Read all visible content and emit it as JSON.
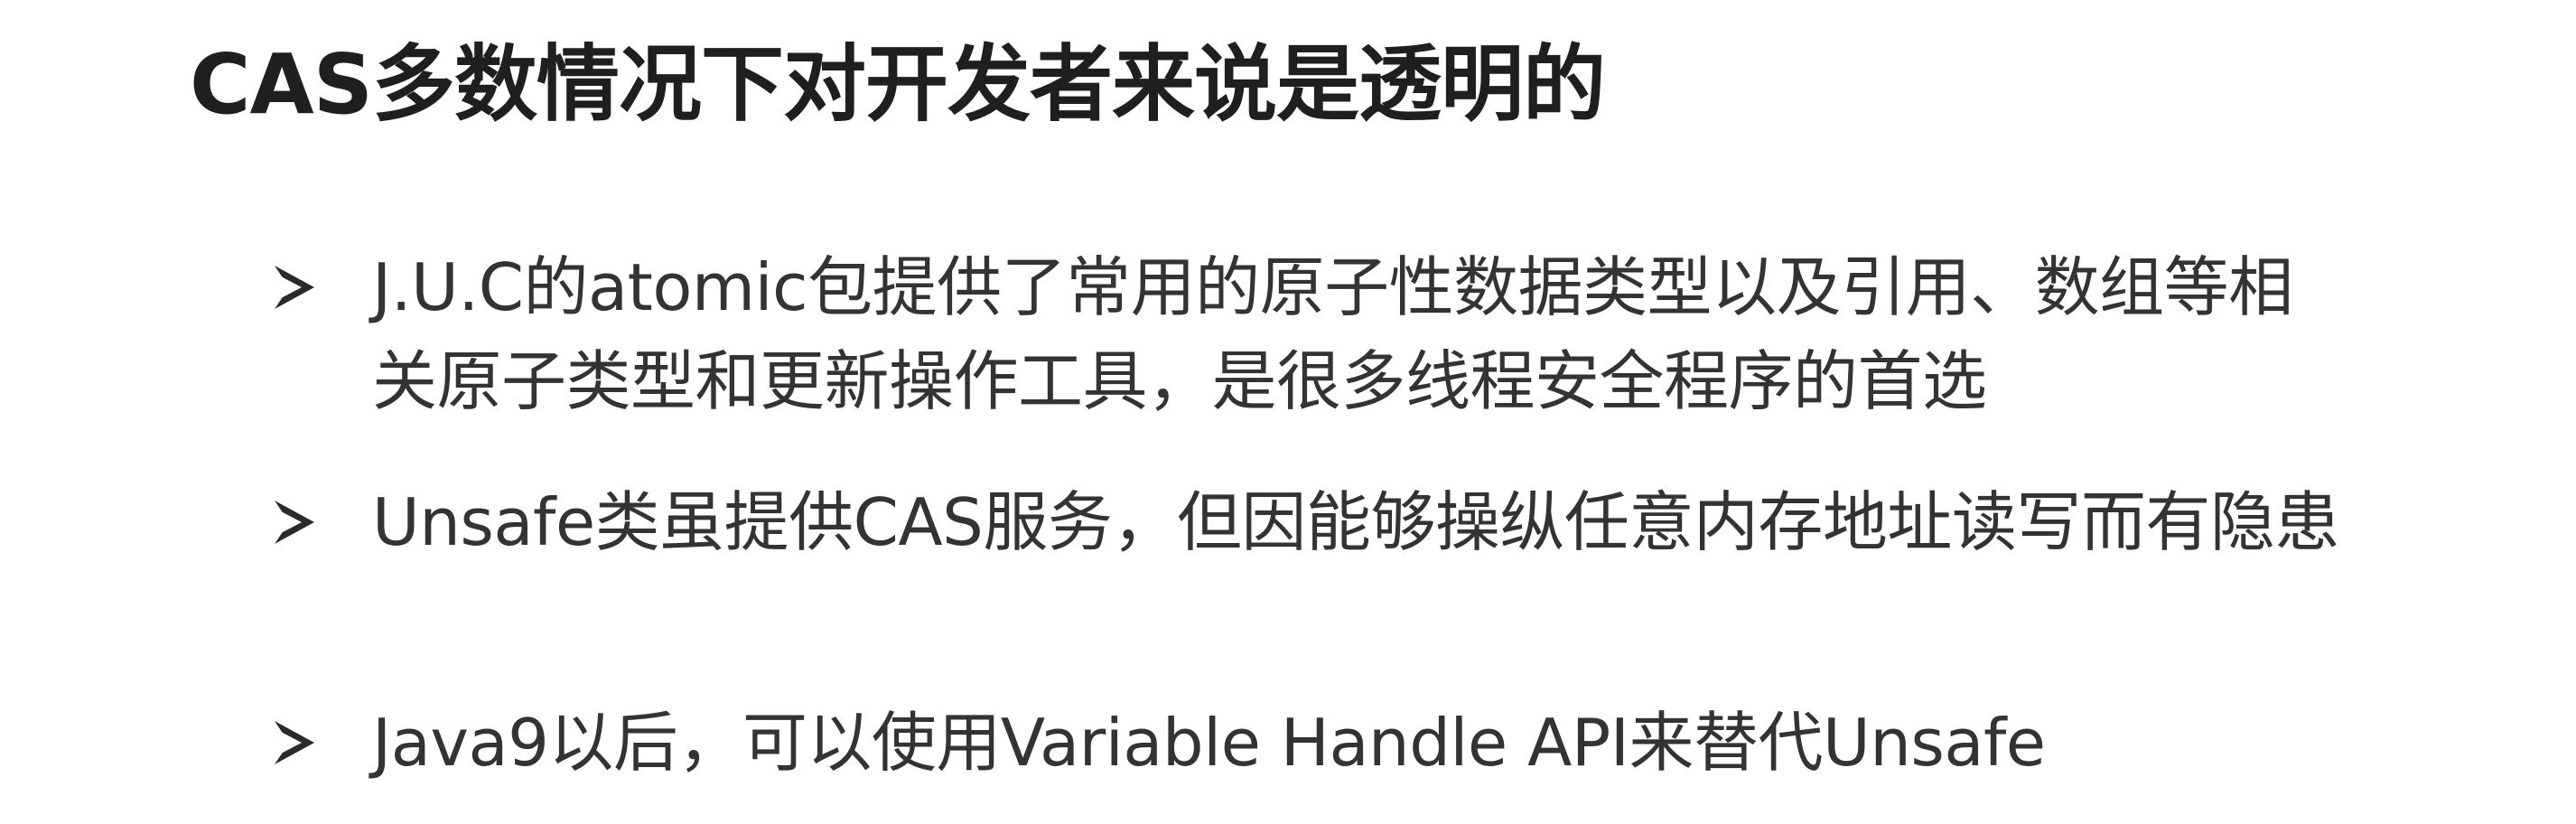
{
  "slide": {
    "title": "CAS多数情况下对开发者来说是透明的",
    "bullets": [
      {
        "marker_icon": "arrowhead-bullet-icon",
        "lines": [
          "J.U.C的atomic包提供了常用的原子性数据类型以及引用、数组等相",
          "关原子类型和更新操作工具，是很多线程安全程序的首选"
        ]
      },
      {
        "marker_icon": "arrowhead-bullet-icon",
        "lines": [
          "Unsafe类虽提供CAS服务，但因能够操纵任意内存地址读写而有隐患"
        ]
      },
      {
        "marker_icon": "arrowhead-bullet-icon",
        "lines": [
          "Java9以后，可以使用Variable Handle API来替代Unsafe"
        ]
      }
    ]
  }
}
